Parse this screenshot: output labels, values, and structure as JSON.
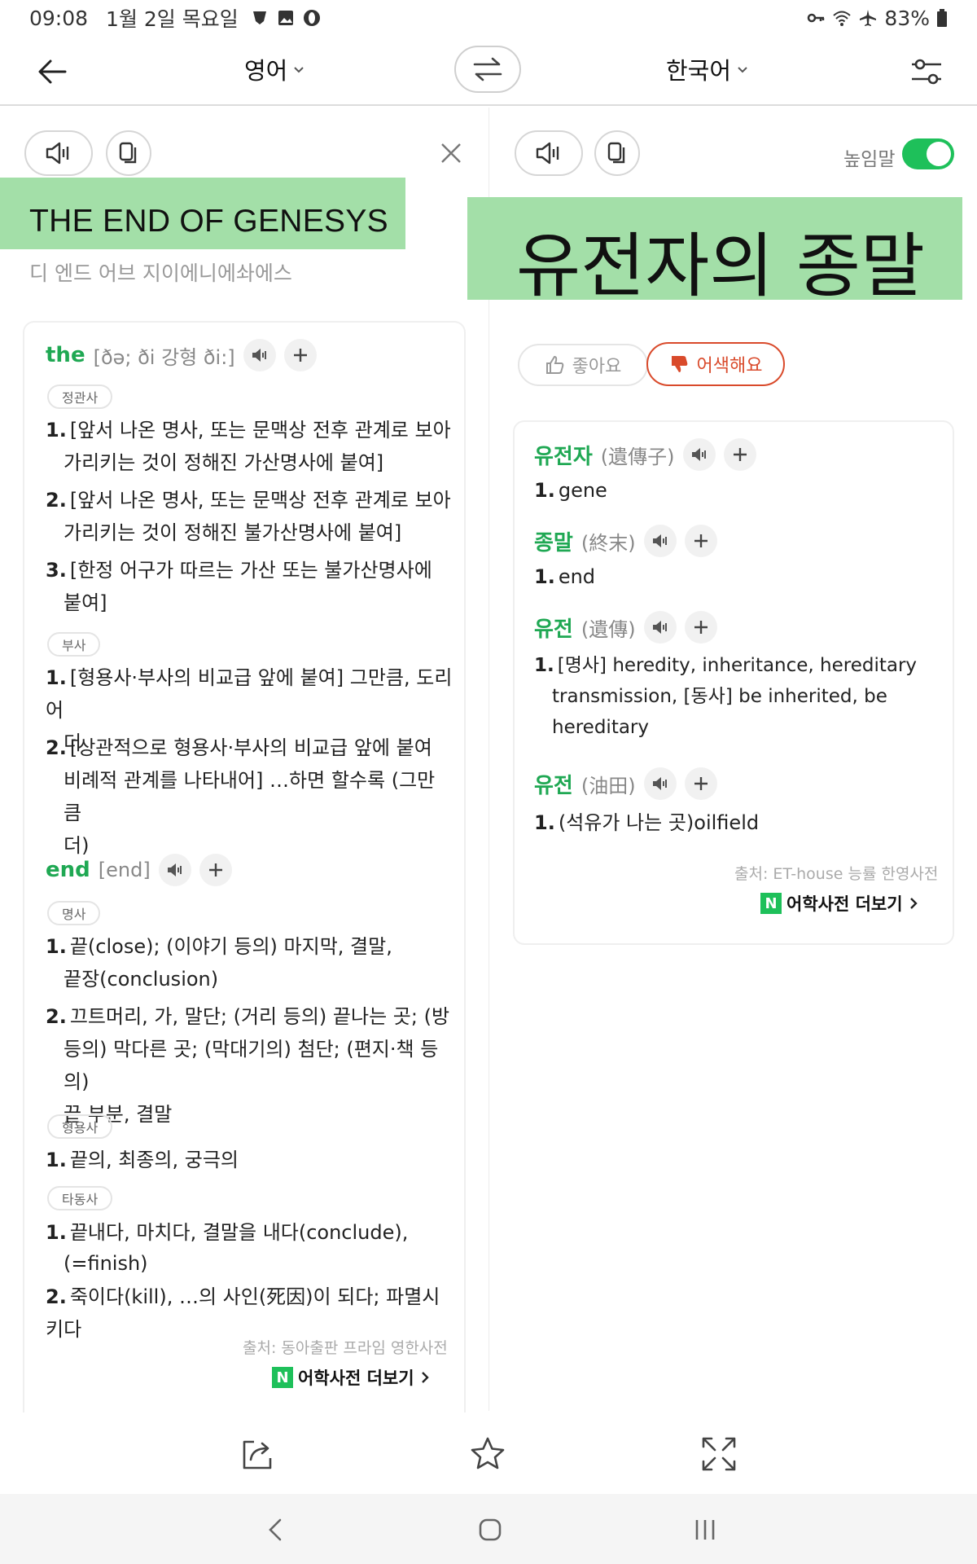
{
  "status": {
    "time": "09:08",
    "date": "1월 2일 목요일",
    "battery": "83%"
  },
  "topbar": {
    "source_lang": "영어",
    "target_lang": "한국어"
  },
  "source": {
    "text": "THE END OF GENESYS",
    "pronunciation": "디 엔드 어브 지이에니에솨에스"
  },
  "target": {
    "text": "유전자의 종말",
    "honorific_label": "높임말",
    "honorific_on": true,
    "like_label": "좋아요",
    "dislike_label": "어색해요"
  },
  "left_dict": {
    "entries": [
      {
        "word": "the",
        "pron": "[ðə; ði 강형 ði:]",
        "groups": [
          {
            "pos": "정관사",
            "defs": [
              {
                "num": "1.",
                "lines": [
                  "[앞서 나온 명사, 또는 문맥상 전후 관계로 보아",
                  "가리키는 것이 정해진 가산명사에 붙여]"
                ]
              },
              {
                "num": "2.",
                "lines": [
                  "[앞서 나온 명사, 또는 문맥상 전후 관계로 보아",
                  "가리키는 것이 정해진 불가산명사에 붙여]"
                ]
              },
              {
                "num": "3.",
                "lines": [
                  "[한정 어구가 따르는 가산 또는 불가산명사에",
                  "붙여]"
                ]
              }
            ]
          },
          {
            "pos": "부사",
            "defs": [
              {
                "num": "1.",
                "lines": [
                  "[형용사·부사의 비교급 앞에 붙여] 그만큼, 도리어",
                  "더"
                ]
              },
              {
                "num": "2.",
                "lines": [
                  "[상관적으로 형용사·부사의 비교급 앞에 붙여",
                  "비례적 관계를 나타내어] …하면 할수록 (그만큼",
                  "더)"
                ]
              }
            ]
          }
        ]
      },
      {
        "word": "end",
        "pron": "[end]",
        "groups": [
          {
            "pos": "명사",
            "defs": [
              {
                "num": "1.",
                "lines": [
                  "끝(close); (이야기 등의) 마지막, 결말,",
                  "끝장(conclusion)"
                ]
              },
              {
                "num": "2.",
                "lines": [
                  "끄트머리, 가, 말단; (거리 등의) 끝나는 곳; (방",
                  "등의) 막다른 곳; (막대기의) 첨단; (편지·책 등의)",
                  "끝 부분, 결말"
                ]
              }
            ]
          },
          {
            "pos": "형용사",
            "defs": [
              {
                "num": "1.",
                "lines": [
                  "끝의, 최종의, 궁극의"
                ]
              }
            ]
          },
          {
            "pos": "타동사",
            "defs": [
              {
                "num": "1.",
                "lines": [
                  "끝내다, 마치다, 결말을 내다(conclude),",
                  "(=finish)"
                ]
              },
              {
                "num": "2.",
                "lines": [
                  "죽이다(kill), …의 사인(死因)이 되다; 파멸시키다"
                ]
              }
            ]
          }
        ]
      }
    ],
    "source": "출처: 동아출판 프라임 영한사전",
    "more": "어학사전 더보기"
  },
  "right_dict": {
    "entries": [
      {
        "word": "유전자",
        "hanja": "(遺傳子)",
        "defs": [
          {
            "num": "1.",
            "lines": [
              "gene"
            ]
          }
        ]
      },
      {
        "word": "종말",
        "hanja": "(終末)",
        "defs": [
          {
            "num": "1.",
            "lines": [
              "end"
            ]
          }
        ]
      },
      {
        "word": "유전",
        "hanja": "(遺傳)",
        "defs": [
          {
            "num": "1.",
            "lines": [
              "[명사] heredity, inheritance, hereditary",
              "transmission, [동사] be inherited, be",
              "hereditary"
            ]
          }
        ]
      },
      {
        "word": "유전",
        "hanja": "(油田)",
        "defs": [
          {
            "num": "1.",
            "lines": [
              "(석유가 나는 곳)oilfield"
            ]
          }
        ]
      }
    ],
    "source": "출처: ET-house 능률 한영사전",
    "more": "어학사전 더보기"
  },
  "colors": {
    "accent_green": "#1fa853",
    "highlight": "#a3dfa8",
    "dislike_red": "#d94a2b"
  },
  "icons": [
    "back-arrow-icon",
    "swap-icon",
    "settings-icon",
    "speaker-icon",
    "copy-icon",
    "close-icon",
    "plus-icon",
    "thumbs-up-icon",
    "thumbs-down-icon",
    "share-icon",
    "star-icon",
    "expand-icon"
  ]
}
